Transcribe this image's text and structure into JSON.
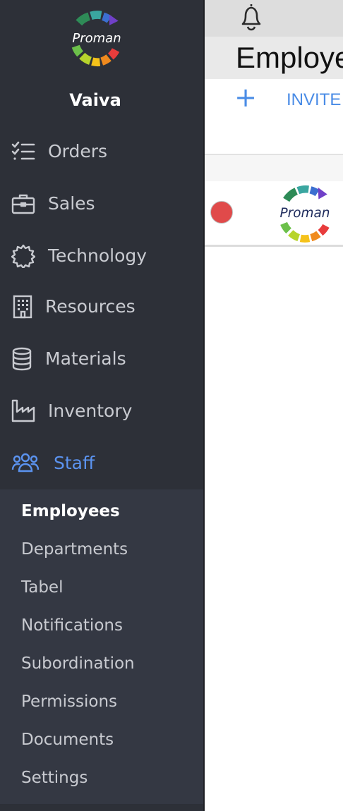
{
  "brand": {
    "logo_text": "Proman"
  },
  "user": {
    "name": "Vaiva"
  },
  "nav": {
    "items": [
      {
        "label": "Orders",
        "icon": "checklist-icon"
      },
      {
        "label": "Sales",
        "icon": "briefcase-icon"
      },
      {
        "label": "Technology",
        "icon": "gear-icon"
      },
      {
        "label": "Resources",
        "icon": "building-icon"
      },
      {
        "label": "Materials",
        "icon": "database-icon"
      },
      {
        "label": "Inventory",
        "icon": "factory-icon"
      },
      {
        "label": "Staff",
        "icon": "users-icon",
        "active": true
      }
    ],
    "submenu": [
      {
        "label": "Employees",
        "active": true
      },
      {
        "label": "Departments"
      },
      {
        "label": "Tabel"
      },
      {
        "label": "Notifications"
      },
      {
        "label": "Subordination"
      },
      {
        "label": "Permissions"
      },
      {
        "label": "Documents"
      },
      {
        "label": "Settings"
      }
    ]
  },
  "header": {
    "title": "Employees",
    "notifications_icon": "bell-icon"
  },
  "toolbar": {
    "add_label": "+",
    "invite_label": "INVITE"
  },
  "table": {
    "rows": [
      {
        "status_color": "#e04a4a",
        "logo_text": "Proman"
      }
    ]
  },
  "colors": {
    "sidebar_bg": "#2d3038",
    "submenu_bg": "#343843",
    "accent": "#5b93f0",
    "action": "#4a8ce6",
    "status_red": "#e04a4a"
  }
}
